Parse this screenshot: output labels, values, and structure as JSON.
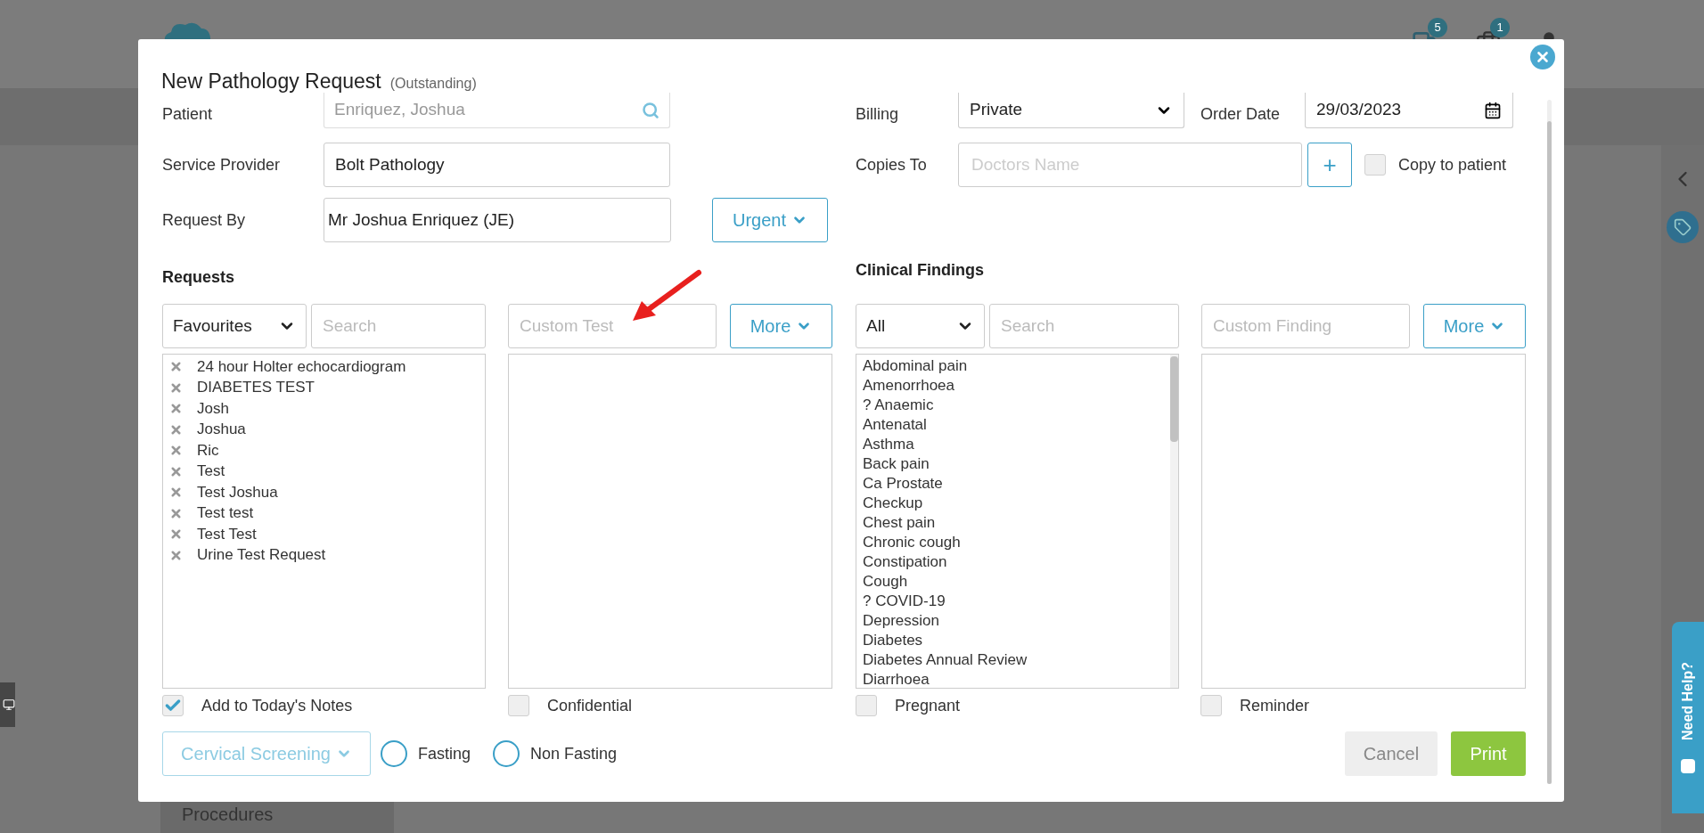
{
  "app": {
    "notifications": "5",
    "messages": "1",
    "sidebar_item": "Procedures",
    "help_tab": "Need Help?"
  },
  "dialog": {
    "title": "New Pathology Request",
    "status": "(Outstanding)",
    "patient": {
      "label": "Patient",
      "value": "Enriquez, Joshua"
    },
    "service_provider": {
      "label": "Service Provider",
      "value": "Bolt Pathology"
    },
    "request_by": {
      "label": "Request By",
      "value": "Mr Joshua Enriquez (JE)"
    },
    "priority_button": "Urgent",
    "billing": {
      "label": "Billing",
      "value": "Private"
    },
    "order_date": {
      "label": "Order Date",
      "value": "29/03/2023"
    },
    "copies_to": {
      "label": "Copies To",
      "placeholder": "Doctors Name",
      "add": "+"
    },
    "copy_to_patient": {
      "label": "Copy to patient",
      "checked": false
    },
    "requests": {
      "heading": "Requests",
      "filter": "Favourites",
      "search_placeholder": "Search",
      "custom_placeholder": "Custom Test",
      "more": "More",
      "items": [
        "24 hour Holter echocardiogram",
        "DIABETES TEST",
        "Josh",
        "Joshua",
        "Ric",
        "Test",
        "Test Joshua",
        "Test test",
        "Test Test",
        "Urine Test Request"
      ],
      "add_to_notes": {
        "label": "Add to Today's Notes",
        "checked": true
      },
      "confidential": {
        "label": "Confidential",
        "checked": false
      }
    },
    "clinical_findings": {
      "heading": "Clinical Findings",
      "filter": "All",
      "search_placeholder": "Search",
      "custom_placeholder": "Custom Finding",
      "more": "More",
      "items": [
        "Abdominal pain",
        "Amenorrhoea",
        "? Anaemic",
        "Antenatal",
        "Asthma",
        "Back pain",
        "Ca Prostate",
        "Checkup",
        "Chest pain",
        "Chronic cough",
        "Constipation",
        "Cough",
        "? COVID-19",
        "Depression",
        "Diabetes",
        "Diabetes Annual Review",
        "Diarrhoea"
      ],
      "pregnant": {
        "label": "Pregnant",
        "checked": false
      },
      "reminder": {
        "label": "Reminder",
        "checked": false
      }
    },
    "cervical_screening": "Cervical Screening",
    "fasting_options": [
      {
        "label": "Fasting",
        "selected": false
      },
      {
        "label": "Non Fasting",
        "selected": false
      }
    ],
    "buttons": {
      "cancel": "Cancel",
      "print": "Print"
    }
  }
}
